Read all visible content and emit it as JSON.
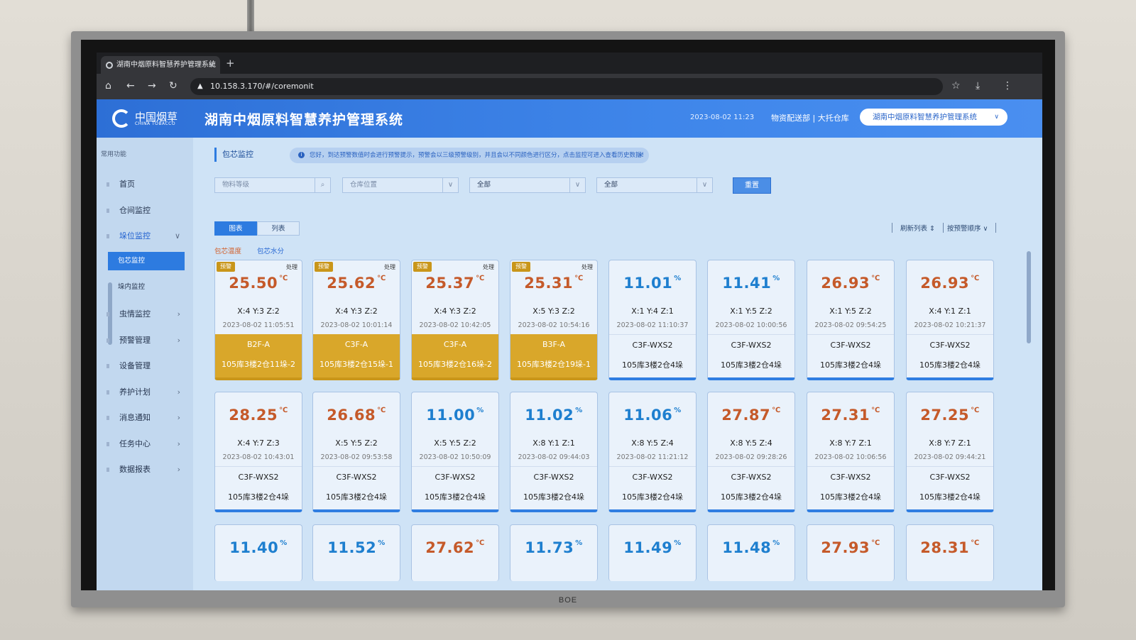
{
  "tv": {
    "brand": "BOE"
  },
  "browser": {
    "tab_title": "湖南中烟原料智慧养护管理系统",
    "tab_close": "×",
    "new_tab": "+",
    "url": "10.158.3.170/#/coremonit"
  },
  "header": {
    "logo_cn": "中国烟草",
    "logo_en": "CHINA TOBACCO",
    "title": "湖南中烟原料智慧养护管理系统",
    "datetime": "2023-08-02 11:23",
    "dept": "物资配送部 | 大托仓库",
    "system_select": "湖南中烟原料智慧养护管理系统"
  },
  "sidebar": {
    "section_title": "常用功能",
    "items": [
      {
        "label": "首页"
      },
      {
        "label": "仓间监控"
      },
      {
        "label": "垛位监控"
      },
      {
        "label": "虫情监控"
      },
      {
        "label": "预警管理"
      },
      {
        "label": "设备管理"
      },
      {
        "label": "养护计划"
      },
      {
        "label": "消息通知"
      },
      {
        "label": "任务中心"
      },
      {
        "label": "数据报表"
      }
    ],
    "sub_items": [
      {
        "label": "包芯监控"
      },
      {
        "label": "垛内监控"
      }
    ]
  },
  "main": {
    "breadcrumb": "包芯监控",
    "notice": "您好，到达预警数值时会进行预警提示，预警会以三级预警级别，并且会以不同颜色进行区分，点击监控可进入查看历史数据!",
    "filters": {
      "material_placeholder": "物料等级",
      "location_placeholder": "仓库位置",
      "select1": "全部",
      "select2": "全部",
      "reset": "重置"
    },
    "view_tabs": [
      "图表",
      "列表"
    ],
    "refresh": "刷新列表",
    "sort": "按预警顺序",
    "sub_tabs": [
      "包芯温度",
      "包芯水分"
    ],
    "badge_label": "预警",
    "handle_label": "处理"
  },
  "cards_row1": [
    {
      "value": "25.50",
      "unit": "℃",
      "xyz": "X:4  Y:3  Z:2",
      "time": "2023-08-02 11:05:51",
      "code": "B2F-A",
      "loc": "105库3楼2仓11垛-2"
    },
    {
      "value": "25.62",
      "unit": "℃",
      "xyz": "X:4  Y:3  Z:2",
      "time": "2023-08-02 10:01:14",
      "code": "C3F-A",
      "loc": "105库3楼2仓15垛-1"
    },
    {
      "value": "25.37",
      "unit": "℃",
      "xyz": "X:4  Y:3  Z:2",
      "time": "2023-08-02 10:42:05",
      "code": "C3F-A",
      "loc": "105库3楼2仓16垛-2"
    },
    {
      "value": "25.31",
      "unit": "℃",
      "xyz": "X:5  Y:3  Z:2",
      "time": "2023-08-02 10:54:16",
      "code": "B3F-A",
      "loc": "105库3楼2仓19垛-1"
    },
    {
      "value": "11.01",
      "unit": "%",
      "xyz": "X:1  Y:4  Z:1",
      "time": "2023-08-02 11:10:37",
      "code": "C3F-WXS2",
      "loc": "105库3楼2仓4垛"
    },
    {
      "value": "11.41",
      "unit": "%",
      "xyz": "X:1  Y:5  Z:2",
      "time": "2023-08-02 10:00:56",
      "code": "C3F-WXS2",
      "loc": "105库3楼2仓4垛"
    },
    {
      "value": "26.93",
      "unit": "℃",
      "xyz": "X:1  Y:5  Z:2",
      "time": "2023-08-02 09:54:25",
      "code": "C3F-WXS2",
      "loc": "105库3楼2仓4垛"
    },
    {
      "value": "26.93",
      "unit": "℃",
      "xyz": "X:4  Y:1  Z:1",
      "time": "2023-08-02 10:21:37",
      "code": "C3F-WXS2",
      "loc": "105库3楼2仓4垛"
    }
  ],
  "cards_row2": [
    {
      "value": "28.25",
      "unit": "℃",
      "xyz": "X:4  Y:7  Z:3",
      "time": "2023-08-02 10:43:01",
      "code": "C3F-WXS2",
      "loc": "105库3楼2仓4垛"
    },
    {
      "value": "26.68",
      "unit": "℃",
      "xyz": "X:5  Y:5  Z:2",
      "time": "2023-08-02 09:53:58",
      "code": "C3F-WXS2",
      "loc": "105库3楼2仓4垛"
    },
    {
      "value": "11.00",
      "unit": "%",
      "xyz": "X:5  Y:5  Z:2",
      "time": "2023-08-02 10:50:09",
      "code": "C3F-WXS2",
      "loc": "105库3楼2仓4垛"
    },
    {
      "value": "11.02",
      "unit": "%",
      "xyz": "X:8  Y:1  Z:1",
      "time": "2023-08-02 09:44:03",
      "code": "C3F-WXS2",
      "loc": "105库3楼2仓4垛"
    },
    {
      "value": "11.06",
      "unit": "%",
      "xyz": "X:8  Y:5  Z:4",
      "time": "2023-08-02 11:21:12",
      "code": "C3F-WXS2",
      "loc": "105库3楼2仓4垛"
    },
    {
      "value": "27.87",
      "unit": "℃",
      "xyz": "X:8  Y:5  Z:4",
      "time": "2023-08-02 09:28:26",
      "code": "C3F-WXS2",
      "loc": "105库3楼2仓4垛"
    },
    {
      "value": "27.31",
      "unit": "℃",
      "xyz": "X:8  Y:7  Z:1",
      "time": "2023-08-02 10:06:56",
      "code": "C3F-WXS2",
      "loc": "105库3楼2仓4垛"
    },
    {
      "value": "27.25",
      "unit": "℃",
      "xyz": "X:8  Y:7  Z:1",
      "time": "2023-08-02 09:44:21",
      "code": "C3F-WXS2",
      "loc": "105库3楼2仓4垛"
    }
  ],
  "cards_row3": [
    {
      "value": "11.40",
      "unit": "%"
    },
    {
      "value": "11.52",
      "unit": "%"
    },
    {
      "value": "27.62",
      "unit": "℃"
    },
    {
      "value": "11.73",
      "unit": "%"
    },
    {
      "value": "11.49",
      "unit": "%"
    },
    {
      "value": "11.48",
      "unit": "%"
    },
    {
      "value": "27.93",
      "unit": "℃"
    },
    {
      "value": "28.31",
      "unit": "℃"
    }
  ]
}
